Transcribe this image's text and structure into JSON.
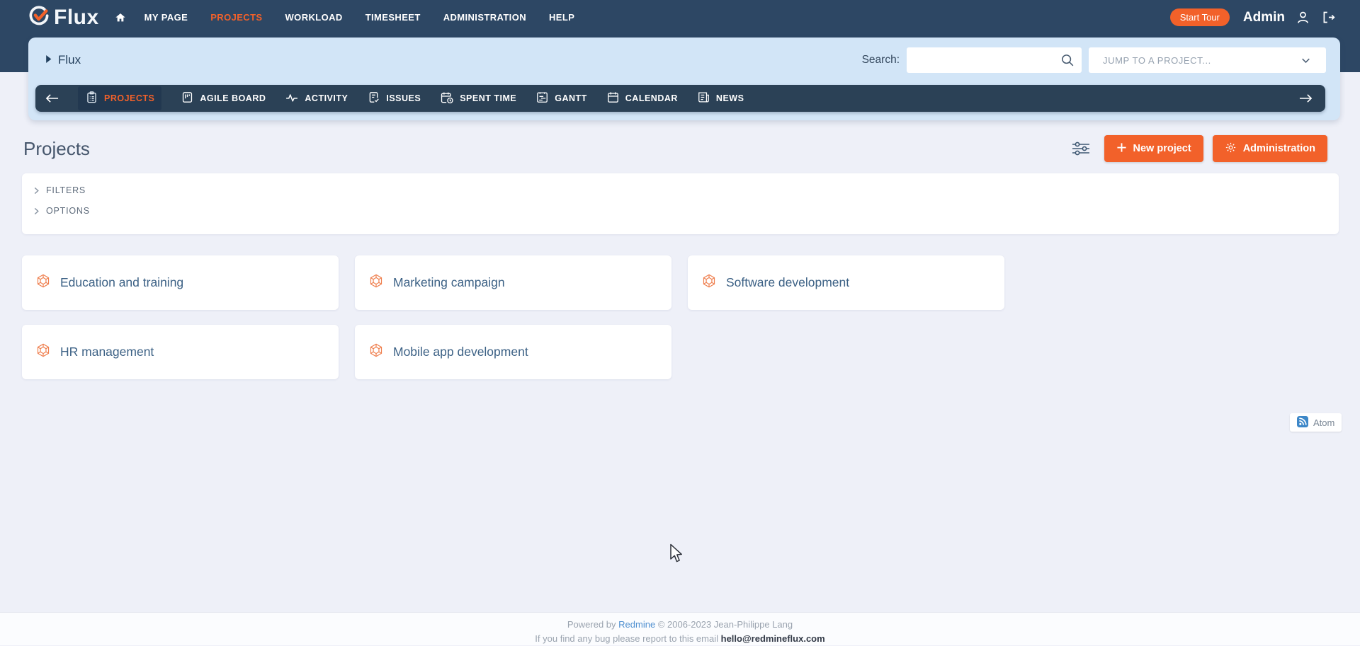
{
  "colors": {
    "accent_orange": "#F2612A",
    "navbar_dark": "#2D4764",
    "pill_dark": "#2B4156",
    "light_blue_band": "#D2E5F7",
    "page_background": "#EEF0F8",
    "link_blue": "#4E8FD0"
  },
  "navbar": {
    "brand": "Flux",
    "logo_icon": "check-circle-icon",
    "home_icon": "home-icon",
    "items": [
      {
        "label": "MY PAGE",
        "active": false
      },
      {
        "label": "PROJECTS",
        "active": true
      },
      {
        "label": "WORKLOAD",
        "active": false
      },
      {
        "label": "TIMESHEET",
        "active": false
      },
      {
        "label": "ADMINISTRATION",
        "active": false
      },
      {
        "label": "HELP",
        "active": false
      }
    ],
    "start_tour_label": "Start Tour",
    "user_name": "Admin",
    "user_icon": "person-icon",
    "logout_icon": "logout-icon"
  },
  "subheader": {
    "breadcrumb": "Flux",
    "breadcrumb_icon": "triangle-right-icon",
    "search_label": "Search:",
    "search_value": "",
    "search_icon": "magnifier-icon",
    "jump_select": "JUMP TO A PROJECT...",
    "jump_icon": "chevron-down-icon"
  },
  "project_menu": {
    "back_icon": "arrow-left-icon",
    "forward_icon": "arrow-right-icon",
    "items": [
      {
        "label": "PROJECTS",
        "icon": "clipboard-list-icon",
        "active": true
      },
      {
        "label": "AGILE BOARD",
        "icon": "kanban-board-icon",
        "active": false
      },
      {
        "label": "ACTIVITY",
        "icon": "activity-pulse-icon",
        "active": false
      },
      {
        "label": "ISSUES",
        "icon": "issue-document-icon",
        "active": false
      },
      {
        "label": "SPENT TIME",
        "icon": "time-calendar-icon",
        "active": false
      },
      {
        "label": "GANTT",
        "icon": "gantt-chart-icon",
        "active": false
      },
      {
        "label": "CALENDAR",
        "icon": "calendar-icon",
        "active": false
      },
      {
        "label": "NEWS",
        "icon": "newspaper-icon",
        "active": false
      }
    ]
  },
  "main": {
    "title": "Projects",
    "filter_icon": "sliders-icon",
    "new_project_label": "New project",
    "new_project_icon": "plus-icon",
    "administration_label": "Administration",
    "administration_icon": "gear-icon",
    "filters_label": "FILTERS",
    "options_label": "OPTIONS",
    "projects": [
      {
        "name": "Education and training",
        "icon": "hexagon-project-icon"
      },
      {
        "name": "Marketing campaign",
        "icon": "hexagon-project-icon"
      },
      {
        "name": "Software development",
        "icon": "hexagon-project-icon"
      },
      {
        "name": "HR management",
        "icon": "hexagon-project-icon"
      },
      {
        "name": "Mobile app development",
        "icon": "hexagon-project-icon"
      }
    ],
    "atom_label": "Atom",
    "atom_icon": "rss-icon"
  },
  "footer": {
    "powered_prefix": "Powered by",
    "powered_link": "Redmine",
    "powered_suffix": "© 2006-2023 Jean-Philippe Lang",
    "bug_prefix": "If you find any bug please report to this email",
    "bug_email": "hello@redmineflux.com"
  }
}
